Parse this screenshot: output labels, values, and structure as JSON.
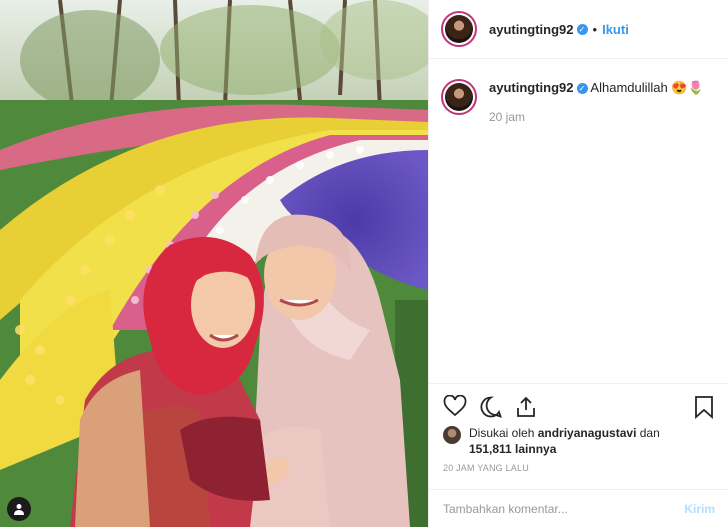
{
  "header": {
    "username": "ayutingting92",
    "verified_badge": "✓",
    "separator": "•",
    "follow_label": "Ikuti"
  },
  "caption": {
    "username": "ayutingting92",
    "text": "Alhamdulillah 😍🌷",
    "time": "20 jam"
  },
  "actions": {
    "icons": [
      "heart-icon",
      "comment-icon",
      "share-icon",
      "bookmark-icon"
    ]
  },
  "likes": {
    "prefix": "Disukai oleh ",
    "user": "andriyanagustavi",
    "middle": " dan ",
    "count": "151,811 lainnya"
  },
  "timestamp": "20 JAM YANG LALU",
  "comment": {
    "placeholder": "Tambahkan komentar...",
    "post_label": "Kirim"
  },
  "colors": {
    "link": "#3897f0",
    "post_disabled": "#b2dffc",
    "muted": "#999999"
  }
}
